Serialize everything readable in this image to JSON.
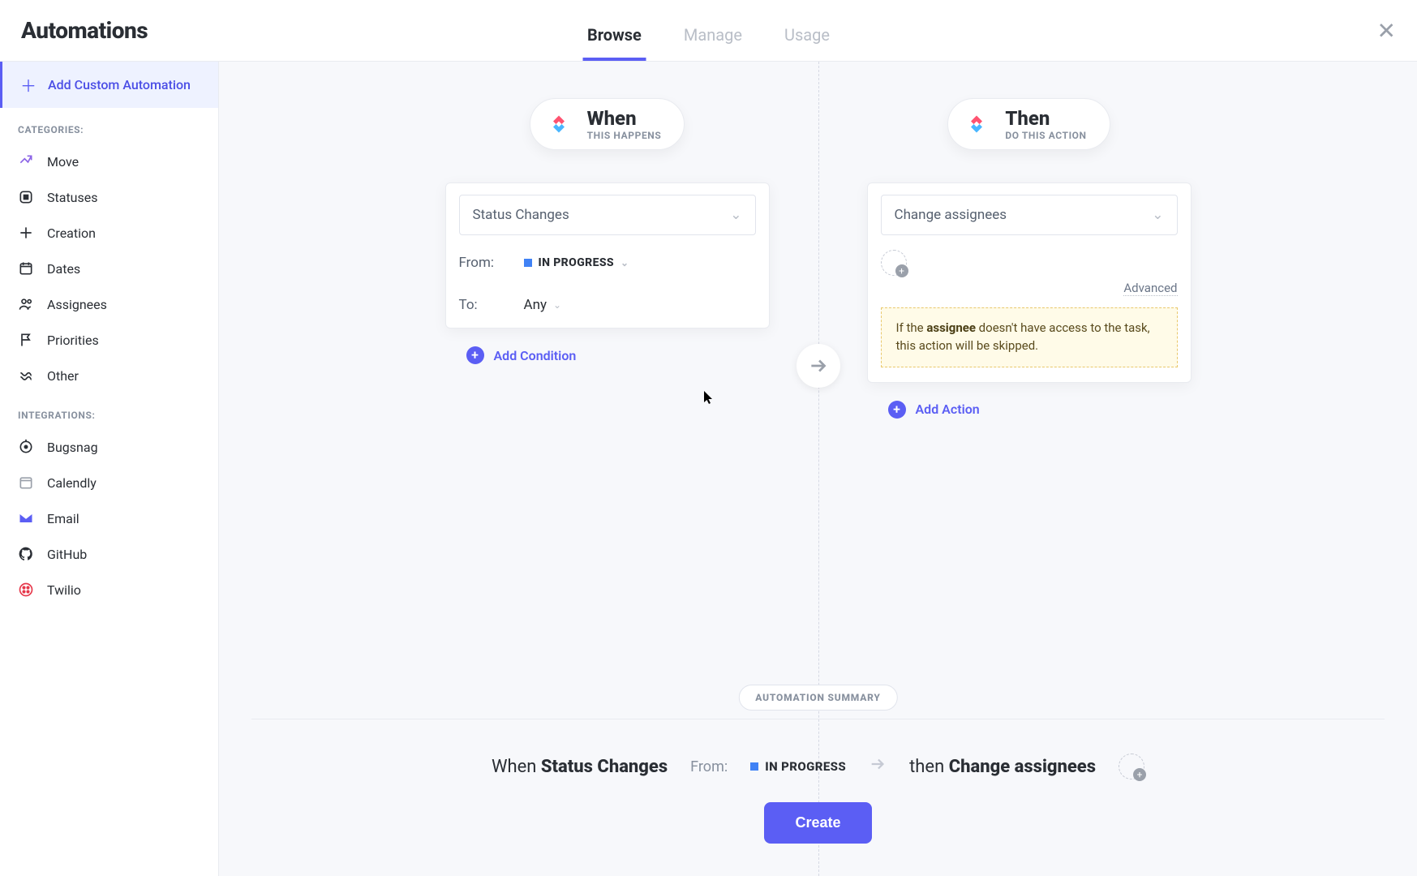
{
  "header": {
    "title": "Automations",
    "tabs": {
      "browse": "Browse",
      "manage": "Manage",
      "usage": "Usage"
    }
  },
  "sidebar": {
    "add_custom": "Add Custom Automation",
    "categories_label": "CATEGORIES:",
    "categories": {
      "move": "Move",
      "statuses": "Statuses",
      "creation": "Creation",
      "dates": "Dates",
      "assignees": "Assignees",
      "priorities": "Priorities",
      "other": "Other"
    },
    "integrations_label": "INTEGRATIONS:",
    "integrations": {
      "bugsnag": "Bugsnag",
      "calendly": "Calendly",
      "email": "Email",
      "github": "GitHub",
      "twilio": "Twilio"
    }
  },
  "when": {
    "title": "When",
    "subtitle": "THIS HAPPENS",
    "trigger": "Status Changes",
    "from_label": "From:",
    "from_value": "IN PROGRESS",
    "to_label": "To:",
    "to_value": "Any",
    "add_condition": "Add Condition"
  },
  "then": {
    "title": "Then",
    "subtitle": "DO THIS ACTION",
    "action": "Change assignees",
    "advanced": "Advanced",
    "warning_prefix": "If the ",
    "warning_bold": "assignee",
    "warning_suffix": " doesn't have access to the task, this action will be skipped.",
    "add_action": "Add Action"
  },
  "summary": {
    "label": "AUTOMATION SUMMARY",
    "when_word": "When",
    "trigger": "Status Changes",
    "from_label": "From:",
    "from_value": "IN PROGRESS",
    "then_word": "then",
    "action": "Change assignees",
    "create": "Create"
  }
}
